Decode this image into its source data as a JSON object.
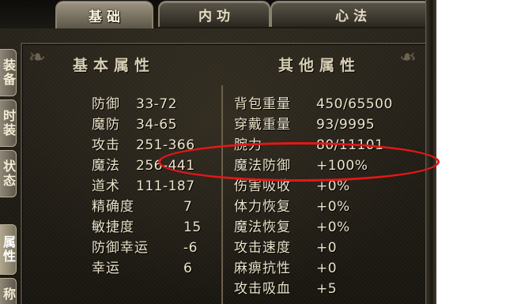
{
  "tabs": [
    {
      "label": "基础"
    },
    {
      "label": "内功"
    },
    {
      "label": "心法"
    }
  ],
  "side_tabs": [
    {
      "label": "装备"
    },
    {
      "label": "时装"
    },
    {
      "label": "状态"
    },
    {
      "label": "属性"
    },
    {
      "label": "称"
    }
  ],
  "basic": {
    "title": "基本属性",
    "rows": [
      {
        "label": "防御",
        "value": "33-72"
      },
      {
        "label": "魔防",
        "value": "34-65"
      },
      {
        "label": "攻击",
        "value": "251-366"
      },
      {
        "label": "魔法",
        "value": "256-441"
      },
      {
        "label": "道术",
        "value": "111-187"
      },
      {
        "label": "精确度",
        "value": "7"
      },
      {
        "label": "敏捷度",
        "value": "15"
      },
      {
        "label": "防御幸运",
        "value": "-6"
      },
      {
        "label": "幸运",
        "value": "6"
      }
    ]
  },
  "other": {
    "title": "其他属性",
    "rows": [
      {
        "label": "背包重量",
        "value": "450/65500"
      },
      {
        "label": "穿戴重量",
        "value": "93/9995"
      },
      {
        "label": "腕力",
        "value": "80/11101"
      },
      {
        "label": "魔法防御",
        "value": "+100%"
      },
      {
        "label": "伤害吸收",
        "value": "+0%"
      },
      {
        "label": "体力恢复",
        "value": "+0%"
      },
      {
        "label": "魔法恢复",
        "value": "+0%"
      },
      {
        "label": "攻击速度",
        "value": "+0"
      },
      {
        "label": "麻痹抗性",
        "value": "+0"
      },
      {
        "label": "攻击吸血",
        "value": "+5"
      }
    ]
  },
  "colors": {
    "highlight": "#e51717",
    "text": "#ece3ca",
    "panel": "#1d1a14"
  }
}
